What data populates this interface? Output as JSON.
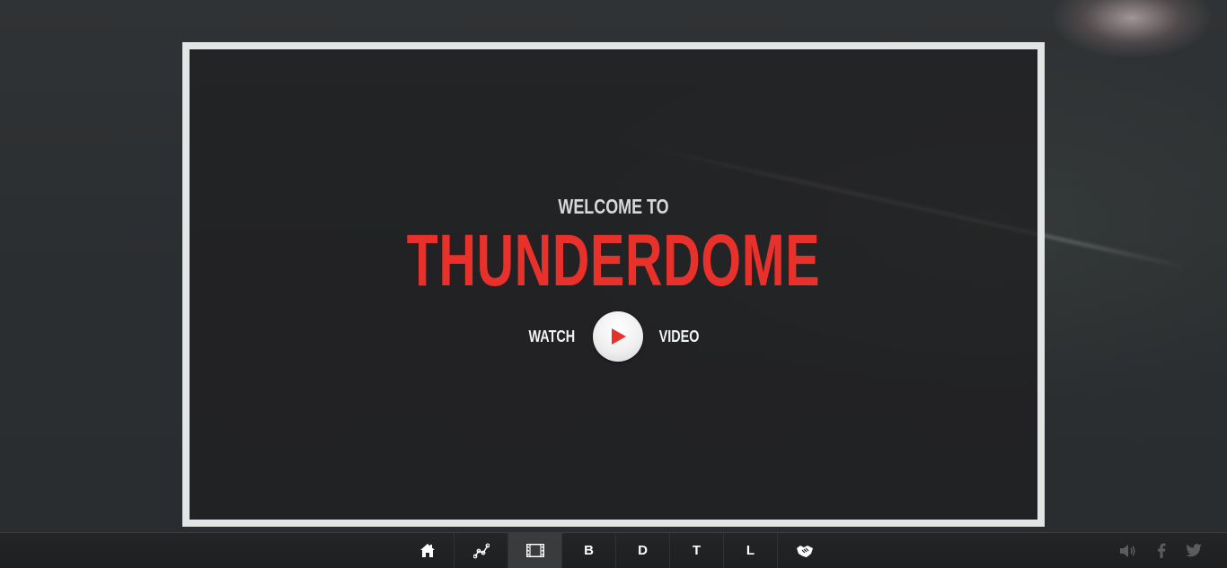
{
  "hero": {
    "welcome": "WELCOME TO",
    "title": "THUNDERDOME",
    "watch_label": "WATCH",
    "video_label": "VIDEO"
  },
  "nav": {
    "items": [
      {
        "icon": "home-icon",
        "label": ""
      },
      {
        "icon": "chart-icon",
        "label": ""
      },
      {
        "icon": "film-icon",
        "label": ""
      },
      {
        "icon": "",
        "label": "B"
      },
      {
        "icon": "",
        "label": "D"
      },
      {
        "icon": "",
        "label": "T"
      },
      {
        "icon": "",
        "label": "L"
      },
      {
        "icon": "handshake-icon",
        "label": ""
      }
    ],
    "active_index": 2
  },
  "social": {
    "icons": [
      "volume-icon",
      "facebook-icon",
      "twitter-icon"
    ]
  },
  "colors": {
    "accent": "#e8312a",
    "frame": "#e3e4e4",
    "background": "#2b2e30",
    "navbar": "#1e1f20"
  }
}
